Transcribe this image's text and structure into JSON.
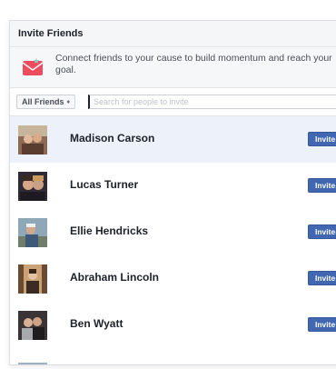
{
  "dialog": {
    "title": "Invite Friends"
  },
  "banner": {
    "icon": "envelope-icon",
    "text": "Connect friends to your cause to build momentum and reach your goal."
  },
  "filter": {
    "label": "All Friends",
    "caret": "♦",
    "search_placeholder": "Search for people to invite",
    "search_value": ""
  },
  "friends": [
    {
      "name": "Madison Carson",
      "invite_label": "Invite",
      "highlighted": true
    },
    {
      "name": "Lucas Turner",
      "invite_label": "Invite",
      "highlighted": false
    },
    {
      "name": "Ellie Hendricks",
      "invite_label": "Invite",
      "highlighted": false
    },
    {
      "name": "Abraham Lincoln",
      "invite_label": "Invite",
      "highlighted": false
    },
    {
      "name": "Ben Wyatt",
      "invite_label": "Invite",
      "highlighted": false
    }
  ],
  "colors": {
    "invite_button": "#4267b2",
    "highlight_row": "#edf2fa",
    "envelope": "#ee4c5c"
  }
}
